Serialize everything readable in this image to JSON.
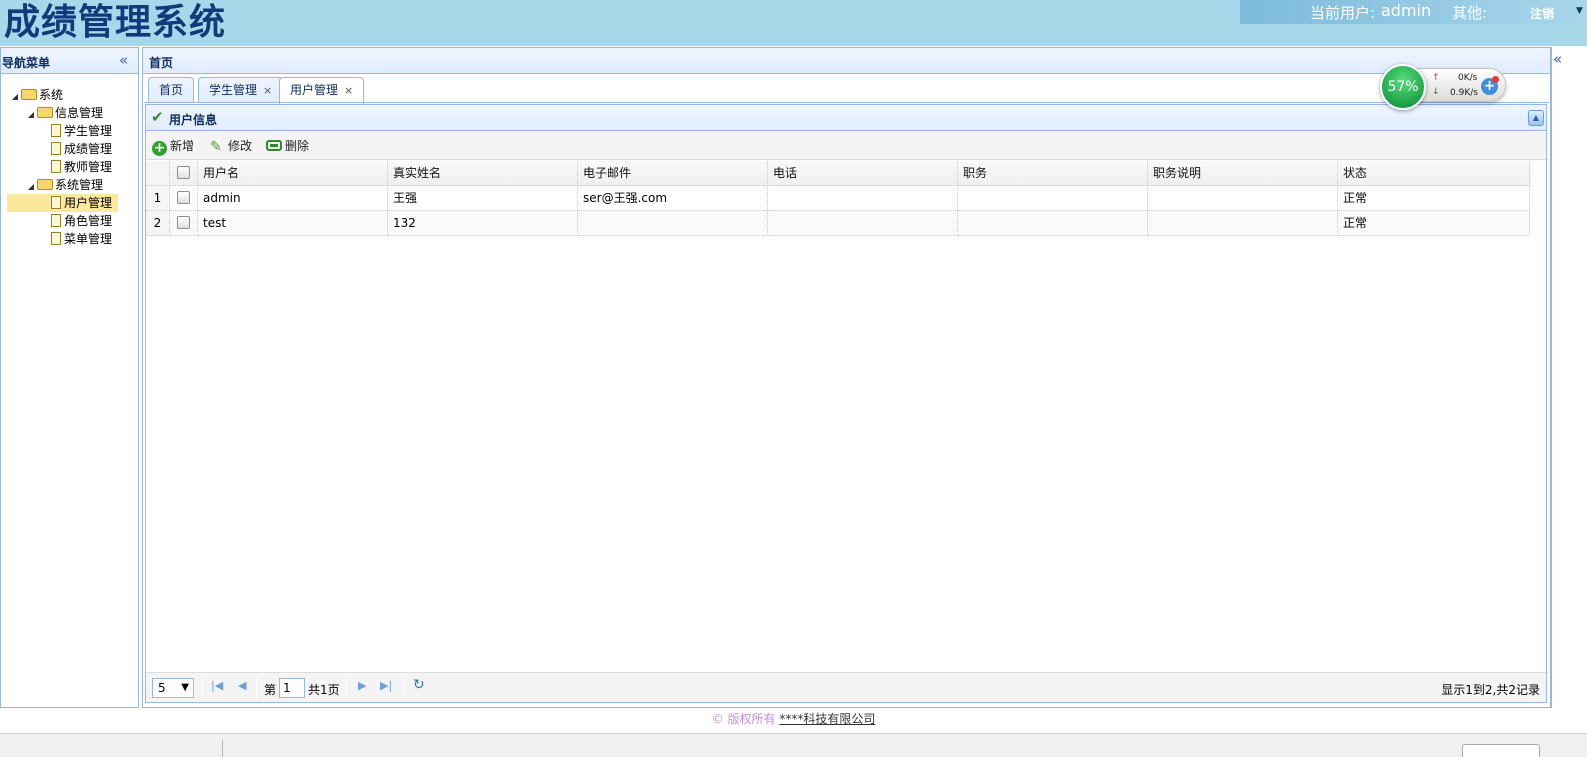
{
  "header": {
    "app_title": "成绩管理系统",
    "current_user_label": "当前用户:",
    "current_user": "admin",
    "other_label": "其他:",
    "logout_label": "注销"
  },
  "nav": {
    "title": "导航菜单",
    "tree": [
      {
        "label": "系统",
        "type": "folder",
        "level": 0
      },
      {
        "label": "信息管理",
        "type": "folder",
        "level": 1
      },
      {
        "label": "学生管理",
        "type": "file",
        "level": 2
      },
      {
        "label": "成绩管理",
        "type": "file",
        "level": 2
      },
      {
        "label": "教师管理",
        "type": "file",
        "level": 2
      },
      {
        "label": "系统管理",
        "type": "folder",
        "level": 1
      },
      {
        "label": "用户管理",
        "type": "file",
        "level": 2,
        "selected": true
      },
      {
        "label": "角色管理",
        "type": "file",
        "level": 2
      },
      {
        "label": "菜单管理",
        "type": "file",
        "level": 2
      }
    ]
  },
  "center": {
    "title": "首页",
    "tabs": [
      {
        "label": "首页",
        "closable": false
      },
      {
        "label": "学生管理",
        "closable": true
      },
      {
        "label": "用户管理",
        "closable": true,
        "active": true
      }
    ]
  },
  "panel": {
    "title": "用户信息",
    "toolbar": {
      "add": "新增",
      "edit": "修改",
      "delete": "删除"
    }
  },
  "grid": {
    "columns": [
      "用户名",
      "真实姓名",
      "电子邮件",
      "电话",
      "职务",
      "职务说明",
      "状态"
    ],
    "rows": [
      {
        "num": "1",
        "cells": [
          "admin",
          "王强",
          "ser@王强.com",
          "",
          "",
          "",
          "正常"
        ]
      },
      {
        "num": "2",
        "cells": [
          "test",
          "132",
          "",
          "",
          "",
          "",
          "正常"
        ]
      }
    ]
  },
  "pager": {
    "page_size": "5",
    "page_prefix": "第",
    "page": "1",
    "page_suffix": "共1页",
    "info": "显示1到2,共2记录"
  },
  "net_widget": {
    "percent": "57%",
    "up": "0K/s",
    "down": "0.9K/s"
  },
  "footer": {
    "copyright": "© 版权所有",
    "company": "****科技有限公司"
  }
}
